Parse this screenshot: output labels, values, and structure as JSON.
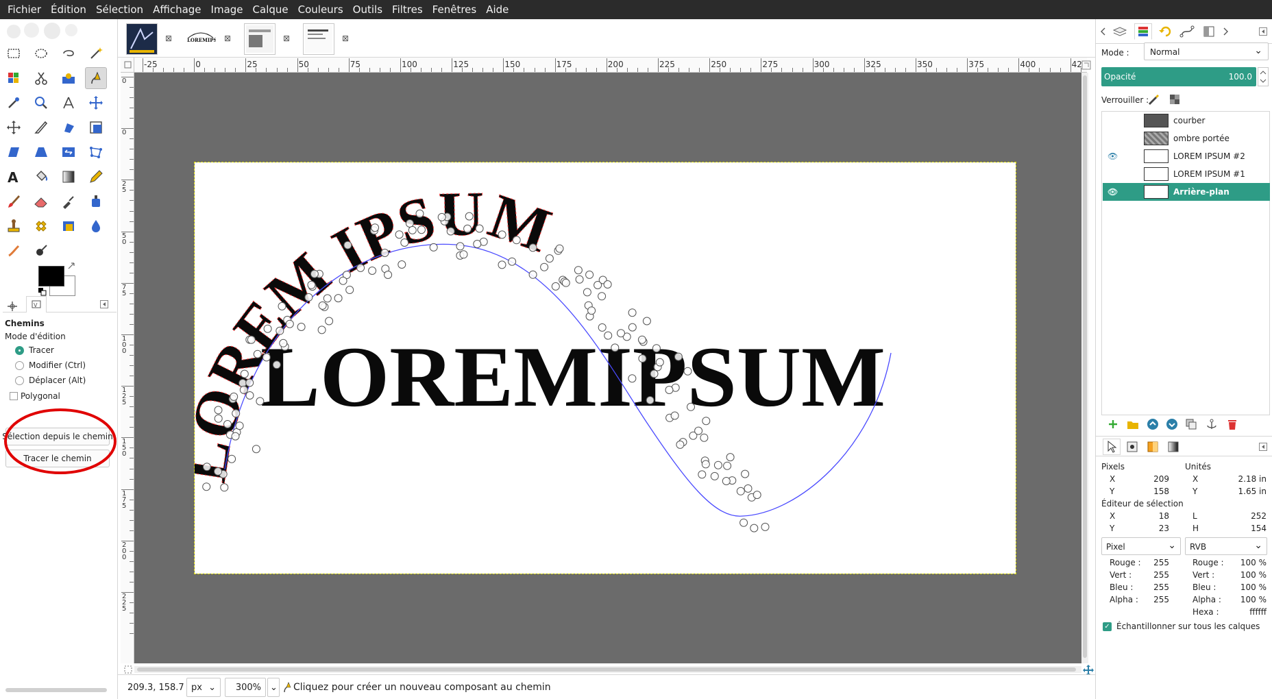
{
  "menubar": {
    "items": [
      "Fichier",
      "Édition",
      "Sélection",
      "Affichage",
      "Image",
      "Calque",
      "Couleurs",
      "Outils",
      "Filtres",
      "Fenêtres",
      "Aide"
    ]
  },
  "tool_options": {
    "title": "Chemins",
    "edit_mode_label": "Mode d'édition",
    "modes": [
      "Tracer",
      "Modifier (Ctrl)",
      "Déplacer (Alt)"
    ],
    "selected_mode": "Tracer",
    "polygonal_label": "Polygonal",
    "selection_from_path_button": "Sélection depuis le chemin",
    "stroke_path_button": "Tracer le chemin"
  },
  "canvas": {
    "ruler_ticks": [
      "-25",
      "0",
      "25",
      "50",
      "75",
      "100",
      "125",
      "150",
      "175",
      "200",
      "225",
      "250",
      "275",
      "300",
      "325",
      "350",
      "375",
      "400",
      "42"
    ],
    "vruler_ticks": [
      "0",
      "0",
      "2 5",
      "5 0",
      "7 5",
      "1 0 0",
      "1 2 5",
      "1 5 0",
      "1 7 5",
      "2 0 0",
      "2 2 5"
    ],
    "straight_text": "LOREMIPSUM",
    "curved_text": "LOREM IPSUM",
    "curve_color": "#4a4aff"
  },
  "status_bar": {
    "coordinates": "209.3, 158.7",
    "unit": "px",
    "zoom": "300%",
    "message": "Cliquez pour créer un nouveau composant au chemin"
  },
  "layers_panel": {
    "mode_label": "Mode :",
    "mode_value": "Normal",
    "opacity_label": "Opacité",
    "opacity_value": "100.0",
    "lock_label": "Verrouiller :",
    "layers": [
      {
        "name": "courber",
        "visible": false,
        "selected": false
      },
      {
        "name": "ombre portée",
        "visible": false,
        "selected": false
      },
      {
        "name": "LOREM IPSUM #2",
        "visible": true,
        "selected": false
      },
      {
        "name": "LOREM IPSUM #1",
        "visible": false,
        "selected": false
      },
      {
        "name": "Arrière-plan",
        "visible": true,
        "selected": true
      }
    ],
    "accent_color": "#2e9c86"
  },
  "pointer_panel": {
    "pixels_label": "Pixels",
    "units_label": "Unités",
    "px_x": "209",
    "px_y": "158",
    "unit_x": "2.18 in",
    "unit_y": "1.65 in",
    "selection_editor_label": "Éditeur de sélection",
    "sel_x": "18",
    "sel_y": "23",
    "sel_w": "252",
    "sel_h": "154",
    "x_label": "X",
    "y_label": "Y",
    "w_label": "L",
    "h_label": "H",
    "left_mode": "Pixel",
    "right_mode": "RVB",
    "left_rows": [
      {
        "label": "Rouge :",
        "value": "255"
      },
      {
        "label": "Vert :",
        "value": "255"
      },
      {
        "label": "Bleu :",
        "value": "255"
      },
      {
        "label": "Alpha :",
        "value": "255"
      }
    ],
    "right_rows": [
      {
        "label": "Rouge :",
        "value": "100 %"
      },
      {
        "label": "Vert :",
        "value": "100 %"
      },
      {
        "label": "Bleu :",
        "value": "100 %"
      },
      {
        "label": "Alpha :",
        "value": "100 %"
      },
      {
        "label": "Hexa :",
        "value": "ffffff"
      }
    ],
    "sample_all_label": "Échantillonner sur tous les calques"
  }
}
